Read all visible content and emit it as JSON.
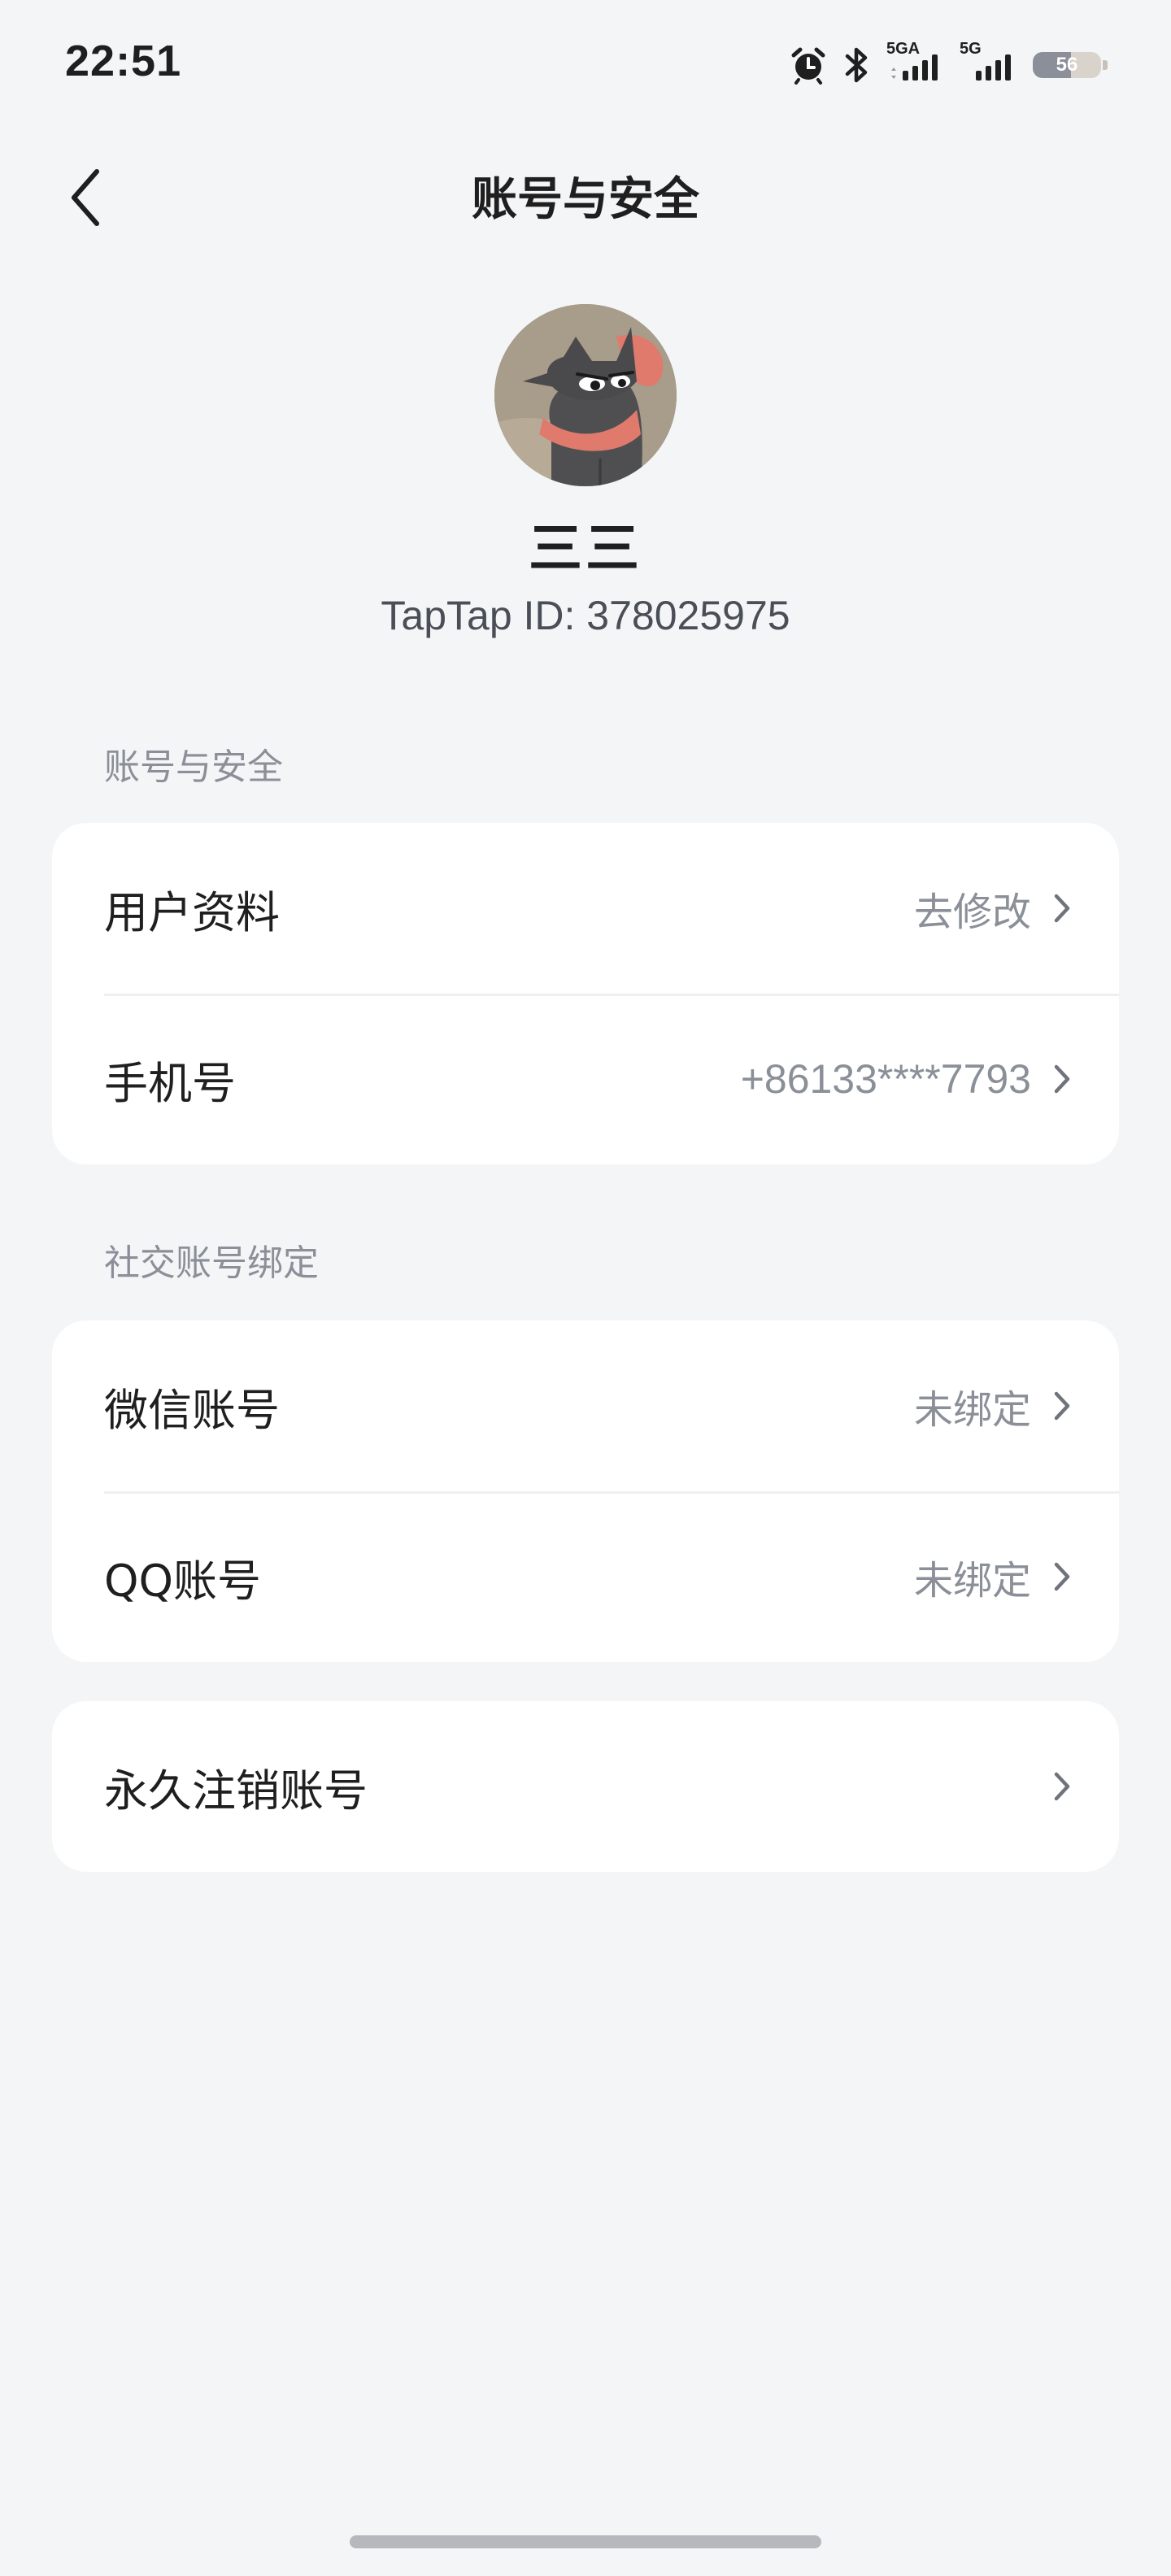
{
  "status_bar": {
    "time": "22:51",
    "network_1": "5GA",
    "network_2": "5G",
    "battery_level": "56",
    "battery_fraction": 0.56,
    "icons": [
      "alarm-icon",
      "bluetooth-icon",
      "signal-5ga-icon",
      "signal-5g-icon",
      "battery-icon"
    ]
  },
  "nav": {
    "back_icon": "chevron-left-icon",
    "title": "账号与安全"
  },
  "profile": {
    "username": "三三",
    "user_id": "TapTap ID: 378025975"
  },
  "section_account": {
    "label": "账号与安全",
    "rows": [
      {
        "label": "用户资料",
        "value": "去修改"
      },
      {
        "label": "手机号",
        "value": "+86133****7793"
      }
    ]
  },
  "section_social": {
    "label": "社交账号绑定",
    "rows": [
      {
        "label": "微信账号",
        "value": "未绑定"
      },
      {
        "label": "QQ账号",
        "value": "未绑定"
      }
    ]
  },
  "section_delete": {
    "rows": [
      {
        "label": "永久注销账号",
        "value": ""
      }
    ]
  },
  "colors": {
    "background": "#f4f5f7",
    "card": "#ffffff",
    "secondary_text": "#8a8f98",
    "primary_text": "#1f1f1f"
  }
}
